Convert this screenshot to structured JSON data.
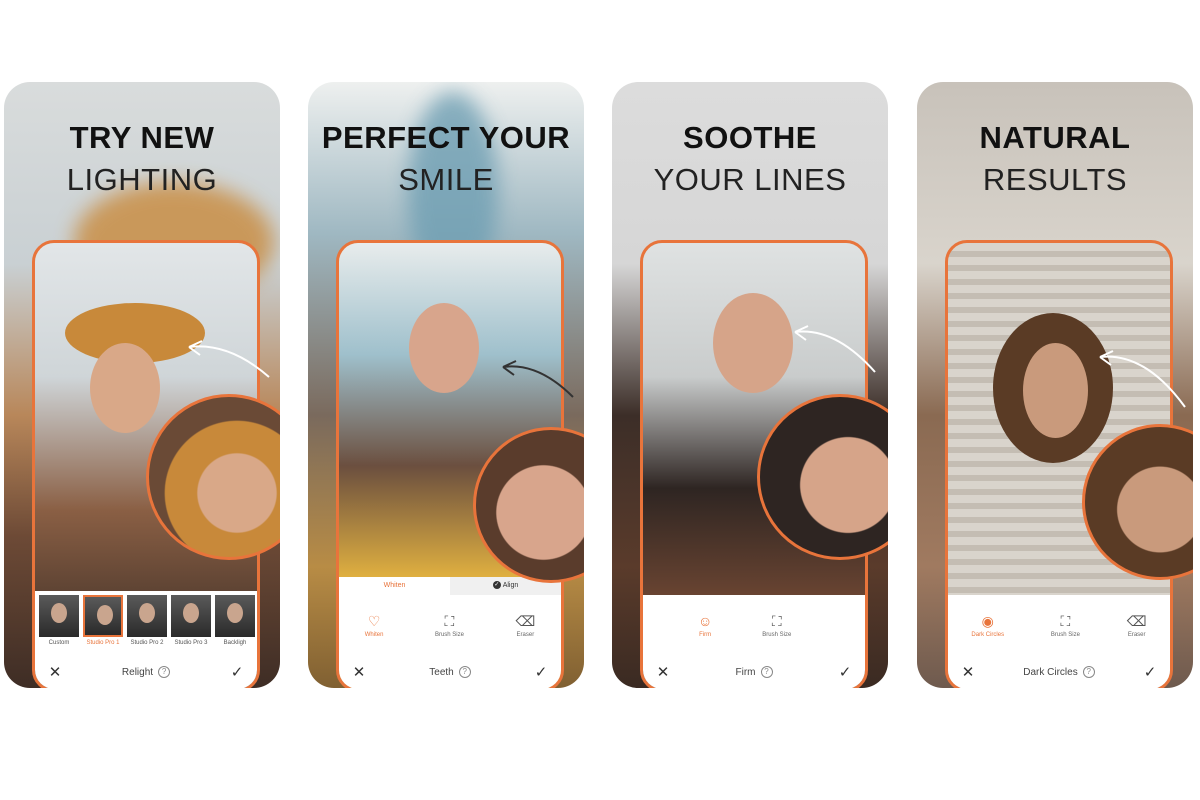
{
  "brand": {
    "accent": "#e8743b"
  },
  "panels": [
    {
      "headline_bold": "TRY NEW",
      "headline_light": "LIGHTING",
      "presets": [
        {
          "label": "Custom",
          "selected": false
        },
        {
          "label": "Studio Pro 1",
          "selected": true
        },
        {
          "label": "Studio Pro 2",
          "selected": false
        },
        {
          "label": "Studio Pro 3",
          "selected": false
        },
        {
          "label": "Backligh",
          "selected": false
        }
      ],
      "titlebar": {
        "cancel_icon": "close-icon",
        "title": "Relight",
        "help": "?",
        "confirm_icon": "check-icon"
      }
    },
    {
      "headline_bold": "PERFECT YOUR",
      "headline_light": "SMILE",
      "segments": [
        {
          "label": "Whiten",
          "active": true
        },
        {
          "label": "Align",
          "active": false
        }
      ],
      "tools": [
        {
          "icon": "tooth-icon",
          "label": "Whiten",
          "active": true
        },
        {
          "icon": "brush-size-icon",
          "label": "Brush Size",
          "active": false
        },
        {
          "icon": "eraser-icon",
          "label": "Eraser",
          "active": false
        }
      ],
      "titlebar": {
        "cancel_icon": "close-icon",
        "title": "Teeth",
        "help": "?",
        "confirm_icon": "check-icon"
      }
    },
    {
      "headline_bold": "SOOTHE",
      "headline_light": "YOUR LINES",
      "tools": [
        {
          "icon": "face-icon",
          "label": "Firm",
          "active": true
        },
        {
          "icon": "brush-size-icon",
          "label": "Brush Size",
          "active": false
        }
      ],
      "titlebar": {
        "cancel_icon": "close-icon",
        "title": "Firm",
        "help": "?",
        "confirm_icon": "check-icon"
      }
    },
    {
      "headline_bold": "NATURAL",
      "headline_light": "RESULTS",
      "tools": [
        {
          "icon": "eye-icon",
          "label": "Dark Circles",
          "active": true
        },
        {
          "icon": "brush-size-icon",
          "label": "Brush Size",
          "active": false
        },
        {
          "icon": "eraser-icon",
          "label": "Eraser",
          "active": false
        }
      ],
      "titlebar": {
        "cancel_icon": "close-icon",
        "title": "Dark Circles",
        "help": "?",
        "confirm_icon": "check-icon"
      }
    }
  ],
  "glyphs": {
    "close": "✕",
    "check": "✓",
    "tooth": "♡",
    "brush": "⛶",
    "eraser": "⌫",
    "face": "☺",
    "eye": "◉",
    "align_check": "✓"
  }
}
